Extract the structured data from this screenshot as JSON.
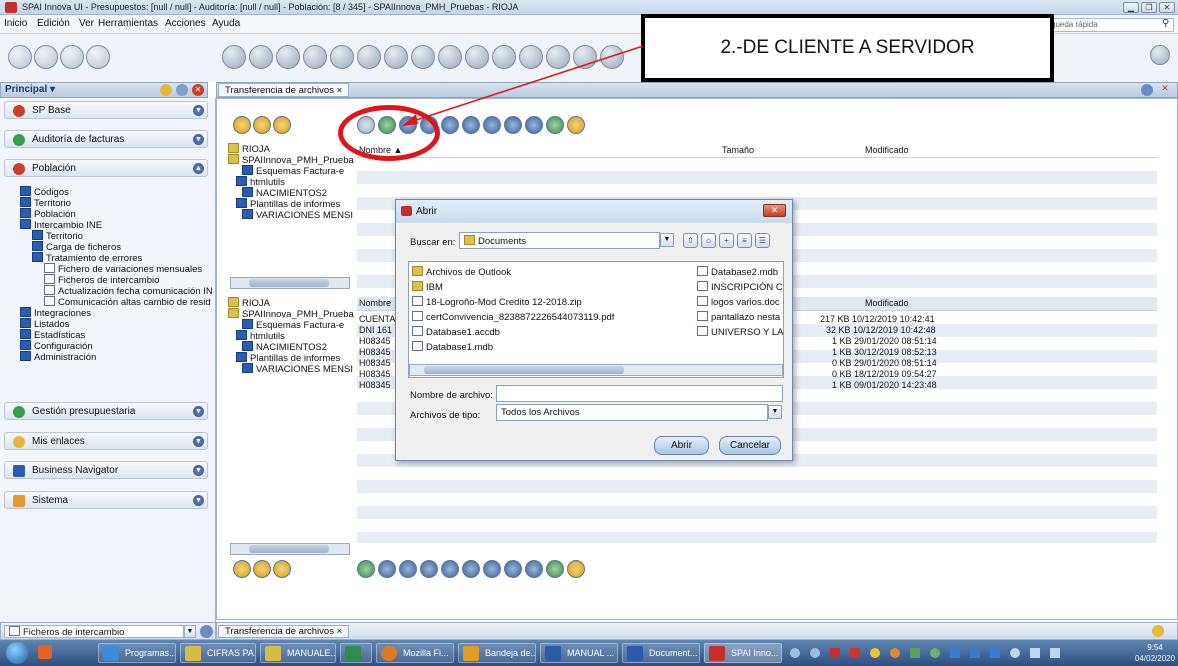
{
  "window": {
    "title": "SPAI Innova UI - Presupuestos: [null / null] - Auditoría: [null / null] - Población: [8 / 345] - SPAIInnova_PMH_Pruebas - RIOJA"
  },
  "menu": [
    "Inicio",
    "Edición",
    "Ver",
    "Herramientas",
    "Acciones",
    "Ayuda"
  ],
  "search": {
    "placeholder": "queda rápida"
  },
  "callout": {
    "text": "2.-DE CLIENTE A SERVIDOR"
  },
  "left": {
    "header": "Principal ▾",
    "panels": {
      "sp_base": "SP Base",
      "auditoria": "Auditoría de facturas",
      "poblacion": "Población",
      "gestion": "Gestión presupuestaria",
      "enlaces": "Mis enlaces",
      "navigator": "Business Navigator",
      "sistema": "Sistema"
    },
    "tree": [
      "Códigos",
      "Territorio",
      "Población",
      "Intercambio INE",
      "Territorio",
      "Carga de ficheros",
      "Tratamiento de errores",
      "Fichero de variaciones mensuales",
      "Ficheros de intercambio",
      "Actualización fecha comunicación IN",
      "Comunicación altas cambio de resid",
      "Integraciones",
      "Listados",
      "Estadísticas",
      "Configuración",
      "Administración"
    ],
    "bottom_select": "Ficheros de intercambio"
  },
  "main": {
    "tab": "Transferencia de archivos ×",
    "client_tree": [
      "RIOJA",
      "SPAIInnova_PMH_Prueba",
      "Esquemas Factura-e",
      "htmlutils",
      "NACIMIENTOS2",
      "Plantillas de informes",
      "VARIACIONES MENSI"
    ],
    "server_tree": [
      "RIOJA",
      "SPAIInnova_PMH_Prueba",
      "Esquemas Factura-e",
      "htmlutils",
      "NACIMIENTOS2",
      "Plantillas de informes",
      "VARIACIONES MENSI"
    ],
    "columns": {
      "name": "Nombre ▲",
      "size": "Tamaño",
      "modified": "Modificado"
    },
    "server_columns": {
      "name": "Nombre",
      "modified": "Modificado"
    },
    "server_rows": [
      {
        "name": "CUENTA",
        "size_modified": "217 KB 10/12/2019 10:42:41"
      },
      {
        "name": "DNI 161",
        "size_modified": "32 KB 10/12/2019 10:42:48"
      },
      {
        "name": "H08345",
        "size_modified": "1 KB 29/01/2020 08:51:14"
      },
      {
        "name": "H08345",
        "size_modified": "1 KB 30/12/2019 08:52:13"
      },
      {
        "name": "H08345",
        "size_modified": "0 KB 29/01/2020 08:51:14"
      },
      {
        "name": "H08345",
        "size_modified": "0 KB 18/12/2019 09:54:27"
      },
      {
        "name": "H08345",
        "size_modified": "1 KB 09/01/2020 14:23:48"
      }
    ],
    "bottom_tab": "Transferencia de archivos ×"
  },
  "dialog": {
    "title": "Abrir",
    "look_in_label": "Buscar en:",
    "look_in_value": "Documents",
    "files_left": [
      "Archivos de Outlook",
      "IBM",
      "18-Logroño-Mod Credito 12-2018.zip",
      "certConvivencia_8238872226544073119.pdf",
      "Database1.accdb",
      "Database1.mdb"
    ],
    "files_right": [
      "Database2.mdb",
      "INSCRIPCIÓN C",
      "logos varios.doc",
      "pantallazo nesta",
      "UNIVERSO Y LA"
    ],
    "filename_label": "Nombre de archivo:",
    "filename_value": "",
    "filetype_label": "Archivos de tipo:",
    "filetype_value": "Todos los Archivos",
    "open_button": "Abrir",
    "cancel_button": "Cancelar"
  },
  "taskbar": {
    "items": [
      "Programas...",
      "CIFRAS PA...",
      "MANUALE...",
      "",
      "Mozilla Fi...",
      "Bandeja de...",
      "MANUAL ...",
      "Document...",
      "SPAI Inno..."
    ],
    "time": "9:54",
    "date": "04/02/2020"
  },
  "colors": {
    "accent": "#2a5db0",
    "callout_ring": "#e0151b",
    "taskbar": "#2d4f80"
  }
}
